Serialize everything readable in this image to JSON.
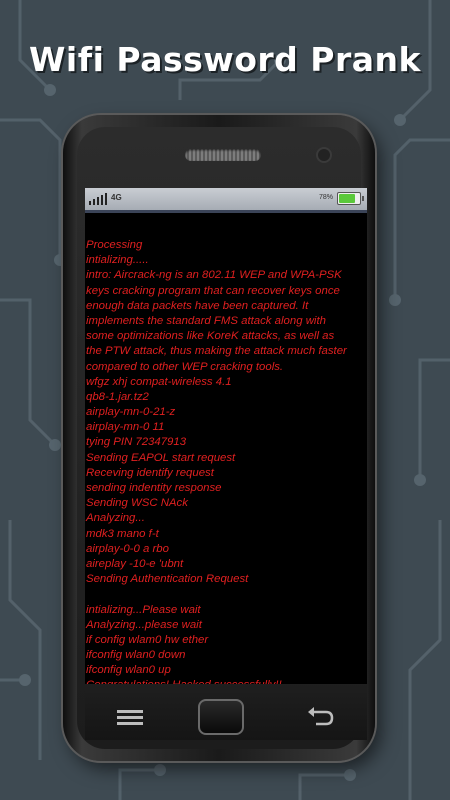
{
  "app": {
    "title": "Wifi Password Prank"
  },
  "statusbar": {
    "network": "4G",
    "battery_percent_label": "78%",
    "battery_level": 0.78
  },
  "console": {
    "lines": [
      "Processing",
      "intializing.....",
      "intro: Aircrack-ng is an 802.11 WEP and WPA-PSK",
      "keys cracking program that can recover keys once",
      "enough data packets have been captured. It",
      "implements the standard FMS attack along with",
      "some optimizations like KoreK attacks, as well as",
      "the PTW attack, thus making the attack much faster",
      "compared to other WEP cracking tools.",
      "wfgz xhj compat-wireless 4.1",
      "qb8-1.jar.tz2",
      "airplay-mn-0-21-z",
      "airplay-mn-0 11",
      "tying PIN 72347913",
      "Sending EAPOL start request",
      "Receving identify request",
      "sending indentity response",
      "Sending WSC NAck",
      "Analyzing...",
      "mdk3 mano f-t",
      "airplay-0-0 a rbo",
      "aireplay -10-e 'ubnt",
      "Sending Authentication Request",
      "",
      "intializing...Please wait",
      "Analyzing...please wait",
      "if config wlam0 hw ether",
      "ifconfig wlan0 down",
      "ifconfig wlan0 up",
      "Congratulations! Hacked successfully!!"
    ]
  },
  "colors": {
    "background": "#3e4a52",
    "console_text": "#e02020",
    "title": "#ffffff"
  },
  "icons": {
    "menu": "menu-icon",
    "home": "home-button",
    "back": "back-icon"
  }
}
